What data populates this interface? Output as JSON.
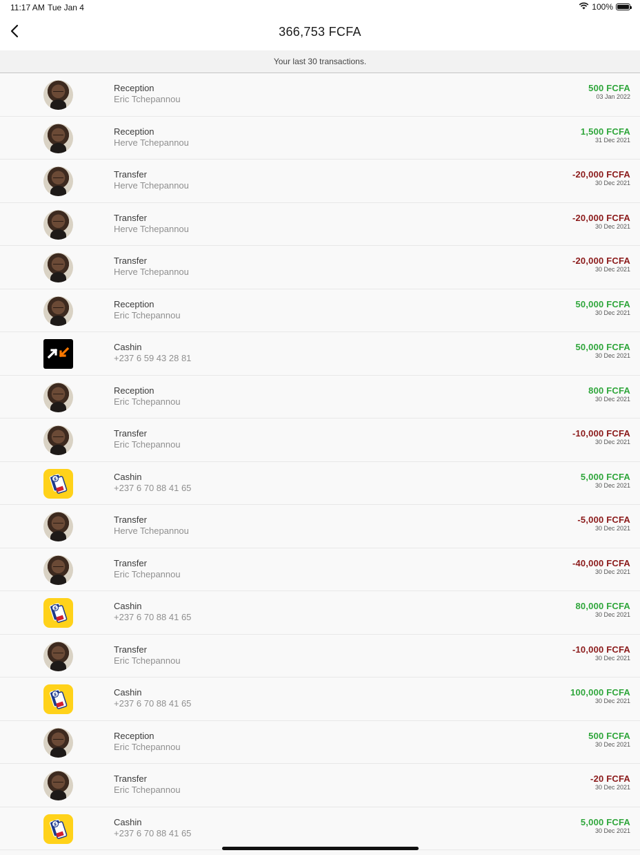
{
  "status_bar": {
    "time": "11:17 AM",
    "date": "Tue Jan 4",
    "battery": "100%"
  },
  "nav": {
    "title": "366,753 FCFA"
  },
  "subheader": "Your last 30 transactions.",
  "colors": {
    "positive": "#2fa63b",
    "negative": "#8b1a1a",
    "cash_logo_bg": "#ffd21a",
    "orange_money": "#ff7900"
  },
  "transactions": [
    {
      "icon": "avatar",
      "type": "Reception",
      "party": "Eric Tchepannou",
      "amount": "500 FCFA",
      "sign": "pos",
      "date": "03 Jan 2022"
    },
    {
      "icon": "avatar",
      "type": "Reception",
      "party": "Herve Tchepannou",
      "amount": "1,500 FCFA",
      "sign": "pos",
      "date": "31 Dec 2021"
    },
    {
      "icon": "avatar",
      "type": "Transfer",
      "party": "Herve Tchepannou",
      "amount": "-20,000 FCFA",
      "sign": "neg",
      "date": "30 Dec 2021"
    },
    {
      "icon": "avatar",
      "type": "Transfer",
      "party": "Herve Tchepannou",
      "amount": "-20,000 FCFA",
      "sign": "neg",
      "date": "30 Dec 2021"
    },
    {
      "icon": "avatar",
      "type": "Transfer",
      "party": "Herve Tchepannou",
      "amount": "-20,000 FCFA",
      "sign": "neg",
      "date": "30 Dec 2021"
    },
    {
      "icon": "avatar",
      "type": "Reception",
      "party": "Eric Tchepannou",
      "amount": "50,000 FCFA",
      "sign": "pos",
      "date": "30 Dec 2021"
    },
    {
      "icon": "orange-money",
      "type": "Cashin",
      "party": "+237 6 59 43 28 81",
      "amount": "50,000 FCFA",
      "sign": "pos",
      "date": "30 Dec 2021"
    },
    {
      "icon": "avatar",
      "type": "Reception",
      "party": "Eric Tchepannou",
      "amount": "800 FCFA",
      "sign": "pos",
      "date": "30 Dec 2021"
    },
    {
      "icon": "avatar",
      "type": "Transfer",
      "party": "Eric Tchepannou",
      "amount": "-10,000 FCFA",
      "sign": "neg",
      "date": "30 Dec 2021"
    },
    {
      "icon": "cash-app",
      "type": "Cashin",
      "party": "+237 6 70 88 41 65",
      "amount": "5,000 FCFA",
      "sign": "pos",
      "date": "30 Dec 2021"
    },
    {
      "icon": "avatar",
      "type": "Transfer",
      "party": "Herve Tchepannou",
      "amount": "-5,000 FCFA",
      "sign": "neg",
      "date": "30 Dec 2021"
    },
    {
      "icon": "avatar",
      "type": "Transfer",
      "party": "Eric Tchepannou",
      "amount": "-40,000 FCFA",
      "sign": "neg",
      "date": "30 Dec 2021"
    },
    {
      "icon": "cash-app",
      "type": "Cashin",
      "party": "+237 6 70 88 41 65",
      "amount": "80,000 FCFA",
      "sign": "pos",
      "date": "30 Dec 2021"
    },
    {
      "icon": "avatar",
      "type": "Transfer",
      "party": "Eric Tchepannou",
      "amount": "-10,000 FCFA",
      "sign": "neg",
      "date": "30 Dec 2021"
    },
    {
      "icon": "cash-app",
      "type": "Cashin",
      "party": "+237 6 70 88 41 65",
      "amount": "100,000 FCFA",
      "sign": "pos",
      "date": "30 Dec 2021"
    },
    {
      "icon": "avatar",
      "type": "Reception",
      "party": "Eric Tchepannou",
      "amount": "500 FCFA",
      "sign": "pos",
      "date": "30 Dec 2021"
    },
    {
      "icon": "avatar",
      "type": "Transfer",
      "party": "Eric Tchepannou",
      "amount": "-20 FCFA",
      "sign": "neg",
      "date": "30 Dec 2021"
    },
    {
      "icon": "cash-app",
      "type": "Cashin",
      "party": "+237 6 70 88 41 65",
      "amount": "5,000 FCFA",
      "sign": "pos",
      "date": "30 Dec 2021"
    }
  ]
}
